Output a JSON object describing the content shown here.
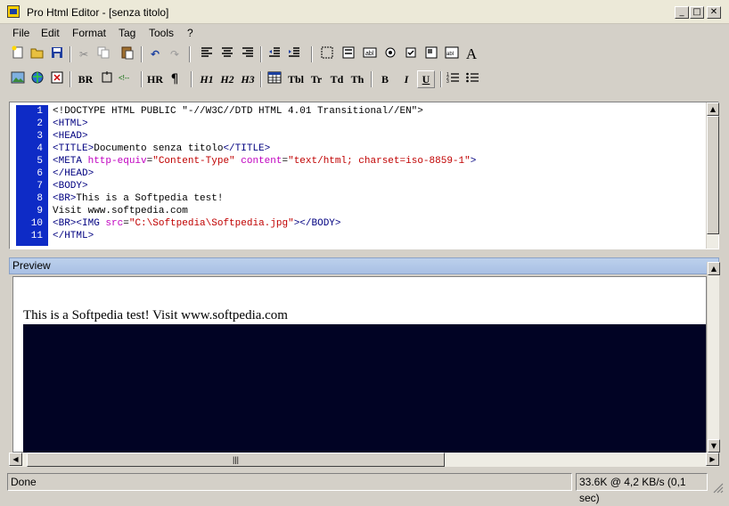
{
  "window": {
    "title": "Pro Html Editor - [senza titolo]"
  },
  "menu": [
    "File",
    "Edit",
    "Format",
    "Tag",
    "Tools",
    "?"
  ],
  "toolbar2": {
    "br": "BR",
    "hr": "HR",
    "para": "¶",
    "h1": "H1",
    "h2": "H2",
    "h3": "H3",
    "tbl": "Tbl",
    "tr": "Tr",
    "td": "Td",
    "th": "Th",
    "bold": "B",
    "italic": "I",
    "underline": "U"
  },
  "editor": {
    "line_numbers": [
      "1",
      "2",
      "3",
      "4",
      "5",
      "6",
      "7",
      "8",
      "9",
      "10",
      "11"
    ],
    "lines": [
      [
        {
          "t": "<!DOCTYPE HTML PUBLIC \"-//W3C//DTD HTML 4.01 Transitional//EN\">",
          "c": ""
        }
      ],
      [
        {
          "t": "<HTML>",
          "c": "tag"
        }
      ],
      [
        {
          "t": "<HEAD>",
          "c": "tag"
        }
      ],
      [
        {
          "t": "<TITLE>",
          "c": "tag"
        },
        {
          "t": "Documento senza titolo",
          "c": ""
        },
        {
          "t": "</TITLE>",
          "c": "tag"
        }
      ],
      [
        {
          "t": "<META ",
          "c": "tag"
        },
        {
          "t": "http-equiv",
          "c": "attr"
        },
        {
          "t": "=",
          "c": ""
        },
        {
          "t": "\"Content-Type\"",
          "c": "str"
        },
        {
          "t": " ",
          "c": ""
        },
        {
          "t": "content",
          "c": "attr"
        },
        {
          "t": "=",
          "c": ""
        },
        {
          "t": "\"text/html; charset=iso-8859-1\"",
          "c": "str"
        },
        {
          "t": ">",
          "c": "tag"
        }
      ],
      [
        {
          "t": "</HEAD>",
          "c": "tag"
        }
      ],
      [
        {
          "t": "<BODY>",
          "c": "tag"
        }
      ],
      [
        {
          "t": "<BR>",
          "c": "tag"
        },
        {
          "t": "This is a Softpedia test!",
          "c": ""
        }
      ],
      [
        {
          "t": "Visit www.softpedia.com",
          "c": ""
        }
      ],
      [
        {
          "t": "<BR>",
          "c": "tag"
        },
        {
          "t": "<IMG ",
          "c": "tag"
        },
        {
          "t": "src",
          "c": "attr"
        },
        {
          "t": "=",
          "c": ""
        },
        {
          "t": "\"C:\\Softpedia\\Softpedia.jpg\"",
          "c": "str"
        },
        {
          "t": ">",
          "c": "tag"
        },
        {
          "t": "</BODY>",
          "c": "tag"
        }
      ],
      [
        {
          "t": "</HTML>",
          "c": "tag"
        }
      ]
    ]
  },
  "preview": {
    "title": "Preview",
    "text": "This is a Softpedia test! Visit www.softpedia.com"
  },
  "status": {
    "left": "Done",
    "right": "33.6K @ 4,2 KB/s (0,1 sec)"
  },
  "colors": {
    "gutter": "#0e2bc6",
    "tag": "#000080",
    "attr": "#c000c0",
    "string": "#c00000",
    "preview_header": "#bcd0ec"
  }
}
